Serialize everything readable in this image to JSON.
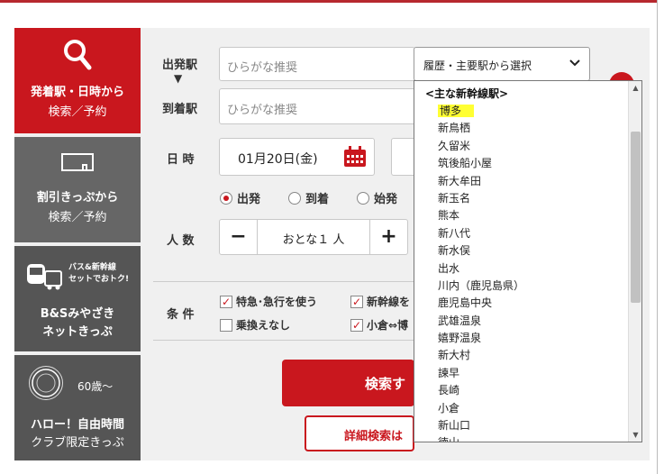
{
  "sidebar": {
    "search": {
      "line1": "発着駅・日時から",
      "line2": "検索／予約"
    },
    "discount": {
      "line1": "割引きっぷから",
      "line2": "検索／予約"
    },
    "bs": {
      "tiny1": "バス&新幹線",
      "tiny2": "セットでおトク!",
      "line1": "B&Sみやざき",
      "line2": "ネットきっぷ"
    },
    "hello": {
      "age": "60歳〜",
      "line1": "ハロー！自由時間",
      "line2": "クラブ限定きっぷ"
    }
  },
  "form": {
    "departure_label": "出発駅",
    "arrival_label": "到着駅",
    "departure_placeholder": "ひらがな推奨",
    "arrival_placeholder": "ひらがな推奨",
    "history_select": "履歴・主要駅から選択",
    "datetime_label": "日 時",
    "date_value": "01月20日(金)",
    "radio_options": [
      "出発",
      "到着",
      "始発"
    ],
    "people_label": "人 数",
    "people_value": "おとな１ 人",
    "conditions_label": "条 件",
    "checks": [
      "特急･急行を使う",
      "新幹線を",
      "乗換えなし",
      "小倉⇔博"
    ],
    "search_button": "検索す",
    "detail_button": "詳細検索は"
  },
  "dropdown": {
    "group_label": "<主な新幹線駅>",
    "options": [
      "博多",
      "新鳥栖",
      "久留米",
      "筑後船小屋",
      "新大牟田",
      "新玉名",
      "熊本",
      "新八代",
      "新水俣",
      "出水",
      "川内（鹿児島県）",
      "鹿児島中央",
      "武雄温泉",
      "嬉野温泉",
      "新大村",
      "諫早",
      "長崎",
      "小倉",
      "新山口",
      "徳山"
    ],
    "highlighted_index": 0
  },
  "colors": {
    "brand_red": "#c9171e",
    "highlight": "#ffff33"
  }
}
